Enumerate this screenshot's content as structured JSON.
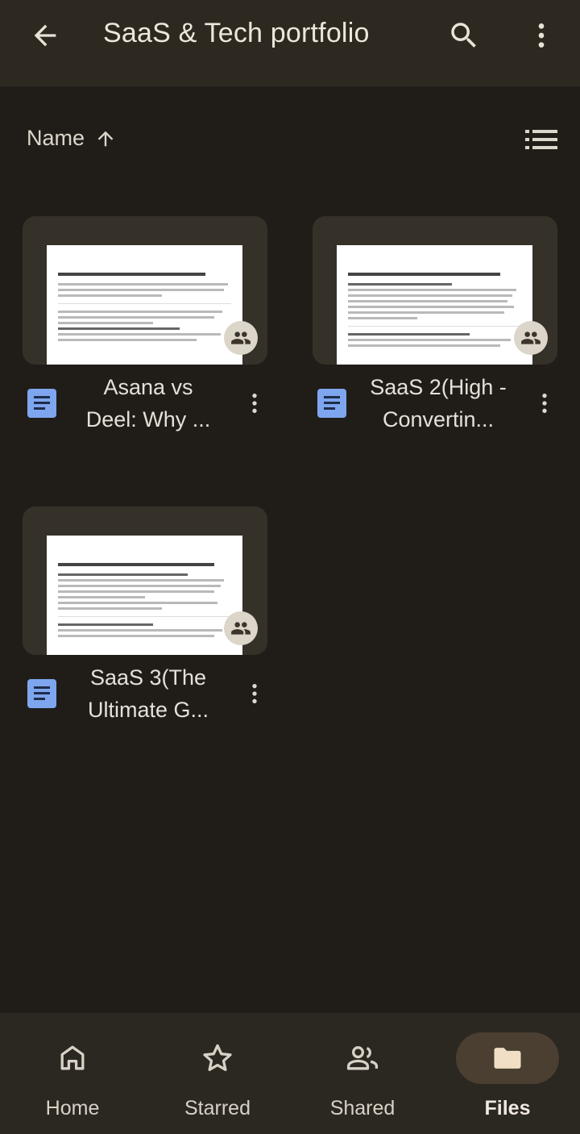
{
  "appbar": {
    "title": "SaaS & Tech portfolio",
    "back_icon": "arrow-back-icon",
    "search_icon": "search-icon",
    "more_icon": "more-vert-icon"
  },
  "sort": {
    "label": "Name",
    "direction": "ascending",
    "view_icon": "list-view-icon"
  },
  "files": [
    {
      "name": "Asana vs Deel: Why ...",
      "type": "document",
      "shared": true,
      "preview_title": "Asana vs Deel: Why Teams Choose a More Intuitive Solution"
    },
    {
      "name": "SaaS 2(High -Convertin...",
      "type": "document",
      "shared": true,
      "preview_title": "High-Converting Case Study: How Miro Reduced Churn by 30%"
    },
    {
      "name": "SaaS 3(The Ultimate G...",
      "type": "document",
      "shared": true,
      "preview_title": "The Ultimate Guide to Mastering B2B SaaS Customer Onboarding"
    }
  ],
  "bottom_nav": [
    {
      "label": "Home",
      "icon": "home-icon",
      "active": false
    },
    {
      "label": "Starred",
      "icon": "star-icon",
      "active": false
    },
    {
      "label": "Shared",
      "icon": "people-icon",
      "active": false
    },
    {
      "label": "Files",
      "icon": "folder-icon",
      "active": true
    }
  ],
  "colors": {
    "background": "#201d19",
    "appbar": "#2d2921",
    "doc_blue": "#7ea6ee",
    "active_pill": "#4a3f31"
  }
}
